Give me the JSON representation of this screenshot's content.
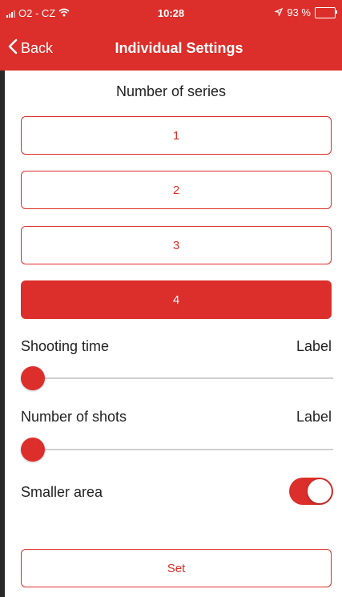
{
  "statusbar": {
    "carrier": "O2 - CZ",
    "time": "10:28",
    "battery_text": "93 %",
    "battery_level": 0.93
  },
  "navbar": {
    "back_label": "Back",
    "title": "Individual Settings"
  },
  "series": {
    "title": "Number of series",
    "options": [
      "1",
      "2",
      "3",
      "4"
    ],
    "selected": "4"
  },
  "shooting_time": {
    "label": "Shooting time",
    "value_label": "Label",
    "slider_value": 0
  },
  "number_of_shots": {
    "label": "Number of shots",
    "value_label": "Label",
    "slider_value": 0
  },
  "smaller_area": {
    "label": "Smaller area",
    "enabled": true
  },
  "set_button": {
    "label": "Set"
  },
  "colors": {
    "accent": "#dc2e2a",
    "track": "#cfcfcf"
  }
}
